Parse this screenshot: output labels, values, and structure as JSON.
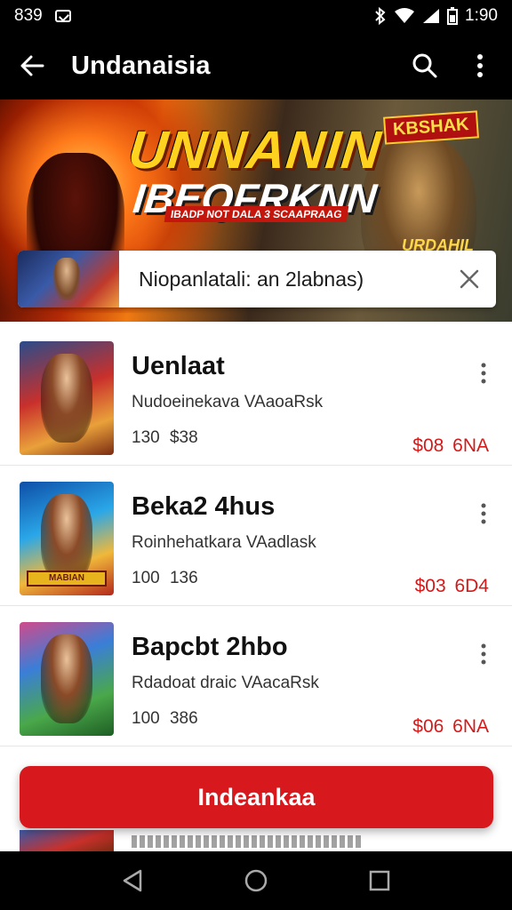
{
  "status_bar": {
    "time_left": "839",
    "time_right": "1:90",
    "icons": [
      "notification-icon",
      "bluetooth-icon",
      "wifi-icon",
      "signal-icon",
      "battery-icon"
    ]
  },
  "app_bar": {
    "title": "Undanaisia",
    "icons": [
      "back-arrow-icon",
      "search-icon",
      "more-vert-icon"
    ]
  },
  "banner": {
    "headline": "UNNANIN",
    "subhead": "IBEQFRKNN",
    "tagline": "IBADP NOT DALA 3 SCAAPRAAG",
    "badge_top": "KBSHAK",
    "badge_bottom": "URDAHIL"
  },
  "search": {
    "value": "Niopanlatali: an 2labnas)"
  },
  "games": [
    {
      "title": "Uenlaat",
      "subtitle": "Nudoeinekava VAaoaRsk",
      "meta": "130 $38",
      "price": "$08 6NA",
      "thumb_label": ""
    },
    {
      "title": "Beka2 4hus",
      "subtitle": "Roinhehatkara VAadlask",
      "meta": "100 136",
      "price": "$03 6D4",
      "thumb_label": "MABIAN"
    },
    {
      "title": "Bapcbt 2hbo",
      "subtitle": "Rdadoat draic VAacaRsk",
      "meta": "100 386",
      "price": "$06 6NA",
      "thumb_label": ""
    }
  ],
  "cta": {
    "label": "Indeankaa"
  },
  "colors": {
    "accent": "#d7181c",
    "price": "#d31a1a",
    "bars": "#000000"
  }
}
